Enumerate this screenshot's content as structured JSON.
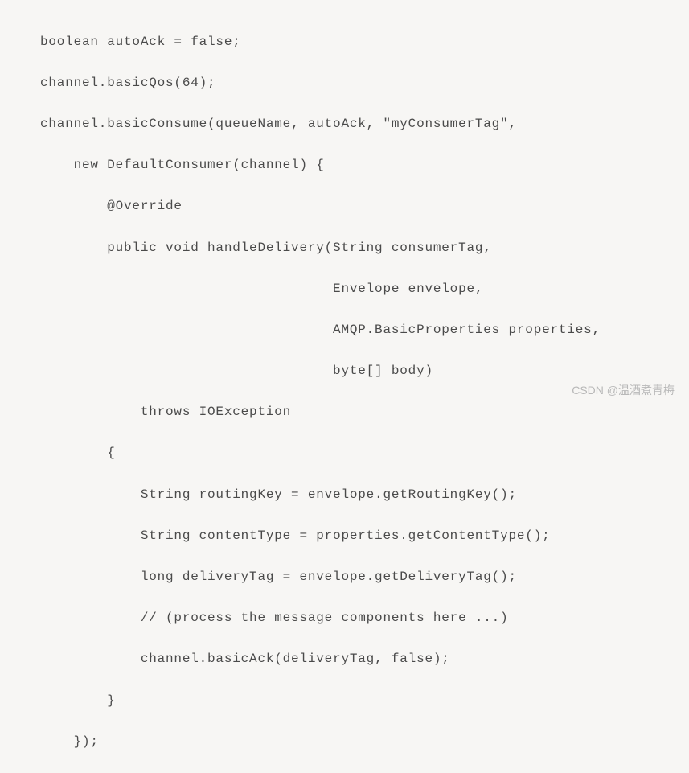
{
  "code": {
    "line1": "boolean autoAck = false;",
    "line2": "channel.basicQos(64);",
    "line3": "channel.basicConsume(queueName, autoAck, \"myConsumerTag\",",
    "line4": "    new DefaultConsumer(channel) {",
    "line5": "        @Override",
    "line6": "        public void handleDelivery(String consumerTag,",
    "line7": "                                   Envelope envelope,",
    "line8": "                                   AMQP.BasicProperties properties,",
    "line9": "                                   byte[] body)",
    "line10": "            throws IOException",
    "line11": "        {",
    "line12": "            String routingKey = envelope.getRoutingKey();",
    "line13": "            String contentType = properties.getContentType();",
    "line14": "            long deliveryTag = envelope.getDeliveryTag();",
    "line15": "            // (process the message components here ...)",
    "line16": "            channel.basicAck(deliveryTag, false);",
    "line17": "        }",
    "line18": "    });"
  },
  "watermark": "CSDN @温酒煮青梅"
}
